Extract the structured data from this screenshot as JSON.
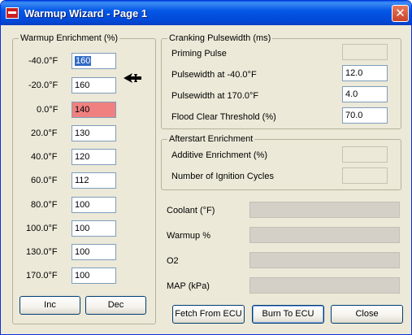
{
  "window": {
    "title": "Warmup Wizard - Page 1"
  },
  "warmup": {
    "legend": "Warmup Enrichment (%)",
    "rows": [
      {
        "label": "-40.0°F",
        "value": "160"
      },
      {
        "label": "-20.0°F",
        "value": "160"
      },
      {
        "label": "0.0°F",
        "value": "140"
      },
      {
        "label": "20.0°F",
        "value": "130"
      },
      {
        "label": "40.0°F",
        "value": "120"
      },
      {
        "label": "60.0°F",
        "value": "112"
      },
      {
        "label": "80.0°F",
        "value": "100"
      },
      {
        "label": "100.0°F",
        "value": "100"
      },
      {
        "label": "130.0°F",
        "value": "100"
      },
      {
        "label": "170.0°F",
        "value": "100"
      }
    ],
    "inc_label": "Inc",
    "dec_label": "Dec"
  },
  "cranking": {
    "legend": "Cranking Pulsewidth (ms)",
    "priming_label": "Priming Pulse",
    "priming_value": "",
    "pw_cold_label": "Pulsewidth at -40.0°F",
    "pw_cold_value": "12.0",
    "pw_hot_label": "Pulsewidth at 170.0°F",
    "pw_hot_value": "4.0",
    "flood_label": "Flood Clear Threshold (%)",
    "flood_value": "70.0"
  },
  "afterstart": {
    "legend": "Afterstart Enrichment",
    "additive_label": "Additive Enrichment (%)",
    "additive_value": "",
    "cycles_label": "Number of Ignition Cycles",
    "cycles_value": ""
  },
  "gauges": {
    "coolant_label": "Coolant (°F)",
    "coolant_level": 0,
    "warmup_label": "Warmup %",
    "warmup_level": 0,
    "o2_label": "O2",
    "o2_level": 0,
    "map_label": "MAP (kPa)",
    "map_level": 0
  },
  "buttons": {
    "fetch_label": "Fetch From ECU",
    "burn_label": "Burn To ECU",
    "close_label": "Close"
  },
  "colors": {
    "titlebar": "#0458e6",
    "warm_cell": "#f08080",
    "selection": "#316ac5"
  }
}
